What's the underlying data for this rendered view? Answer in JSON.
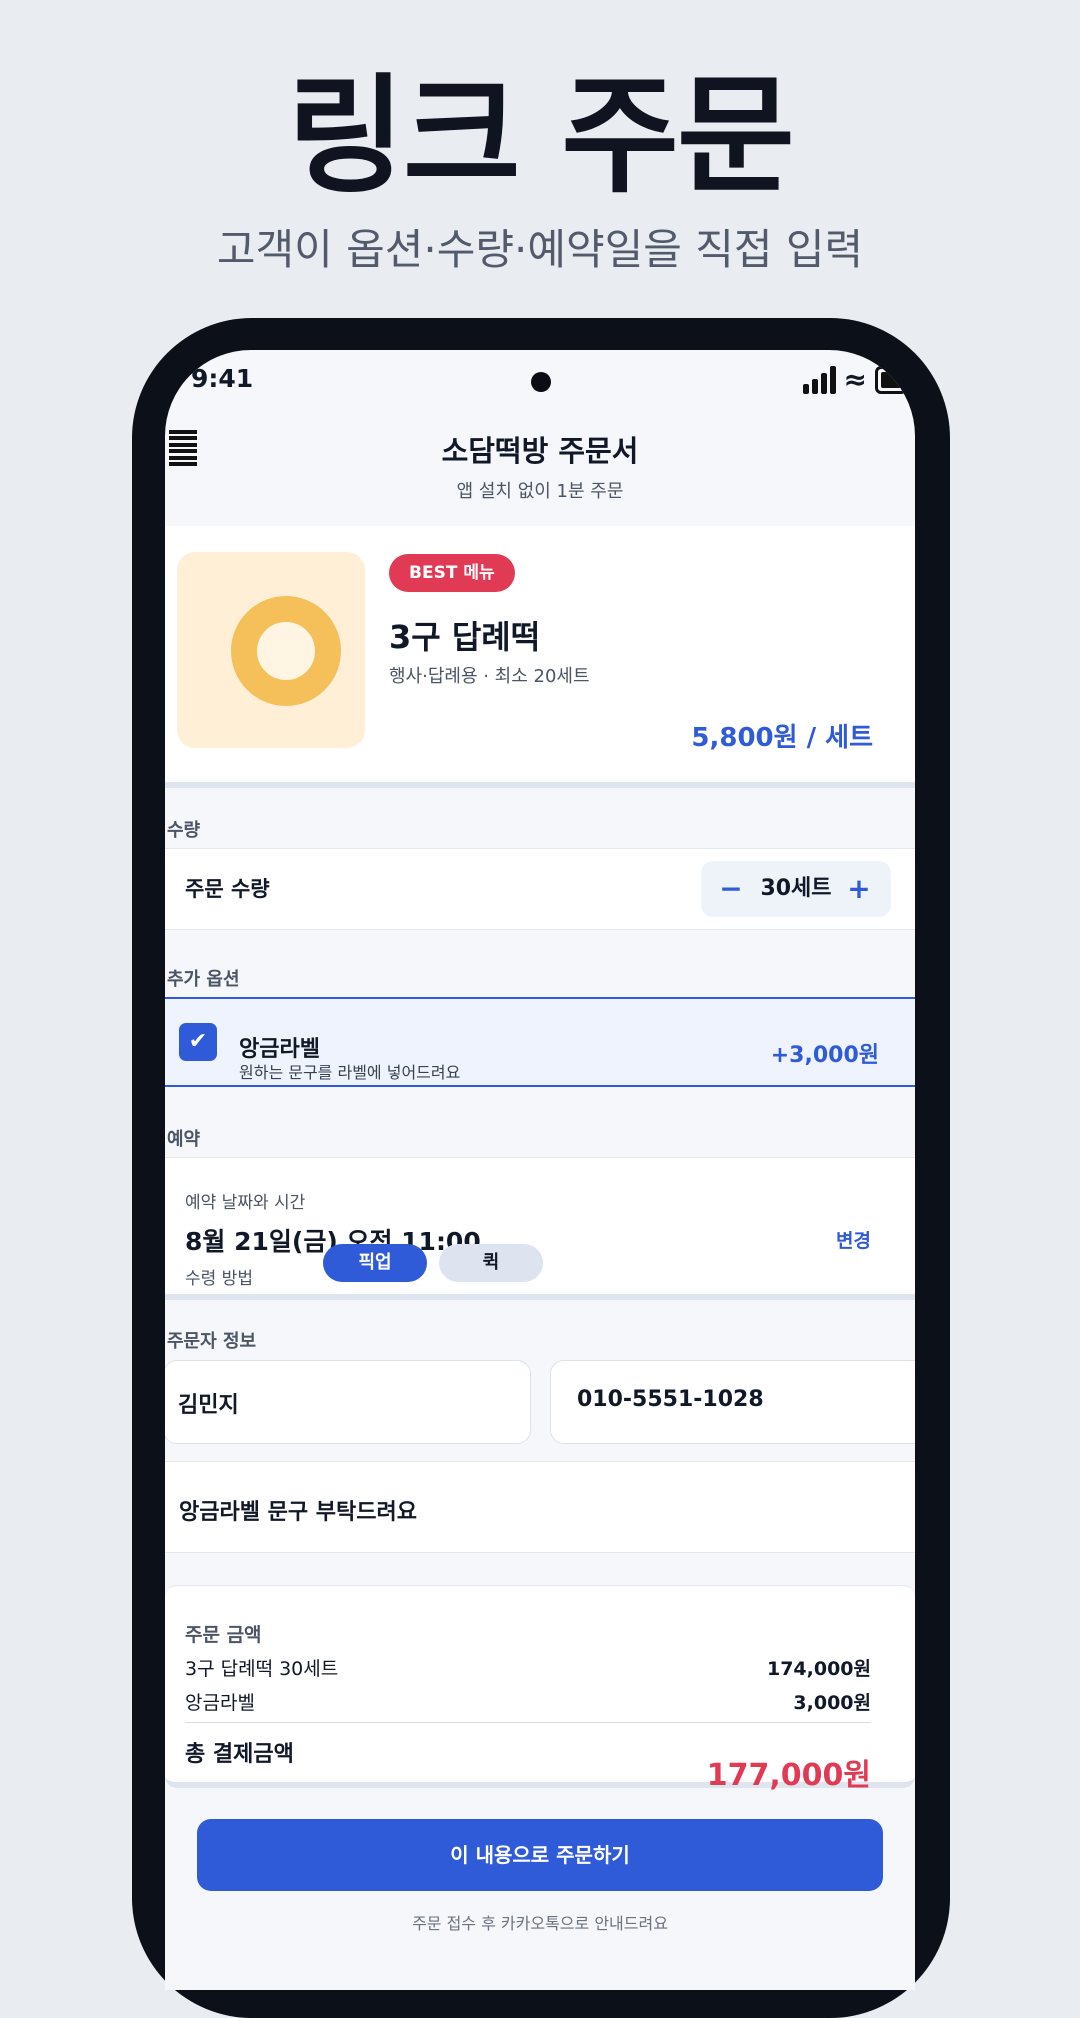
{
  "hero": {
    "title": "링크 주문",
    "subtitle": "고객이 옵션·수량·예약일을 직접 입력"
  },
  "status_bar": {
    "time": "9:41"
  },
  "header": {
    "title": "소담떡방 주문서",
    "subtitle": "앱 설치 없이 1분 주문"
  },
  "product": {
    "badge": "BEST 메뉴",
    "name": "3구 답례떡",
    "description": "행사·답례용 · 최소 20세트",
    "price": "5,800원 / 세트"
  },
  "quantity": {
    "section_label": "수량",
    "label": "주문 수량",
    "minus": "−",
    "value": "30세트",
    "plus": "+"
  },
  "options": {
    "section_label": "추가 옵션",
    "item": {
      "checked": true,
      "check_glyph": "✔",
      "name": "앙금라벨",
      "description": "원하는 문구를 라벨에 넣어드려요",
      "price": "+3,000원"
    }
  },
  "reservation": {
    "section_label": "예약",
    "label": "예약 날짜와 시간",
    "datetime": "8월 21일(금) 오전 11:00",
    "change_label": "변경",
    "receive_label": "수령 방법",
    "methods": [
      "픽업",
      "퀵"
    ],
    "selected_method": "픽업"
  },
  "orderer": {
    "section_label": "주문자 정보",
    "name": "김민지",
    "phone": "010-5551-1028",
    "memo": "앙금라벨 문구 부탁드려요"
  },
  "summary": {
    "title": "주문 금액",
    "lines": [
      {
        "label": "3구 답례떡 30세트",
        "value": "174,000원"
      },
      {
        "label": "앙금라벨",
        "value": "3,000원"
      }
    ],
    "total_label": "총 결제금액",
    "total_value": "177,000원"
  },
  "submit": {
    "label": "이 내용으로 주문하기",
    "footnote": "주문 접수 후 카카오톡으로 안내드려요"
  },
  "colors": {
    "accent": "#2f5bd9",
    "badge": "#e03a55",
    "total": "#e03a55",
    "page_bg": "#e9edf2"
  }
}
